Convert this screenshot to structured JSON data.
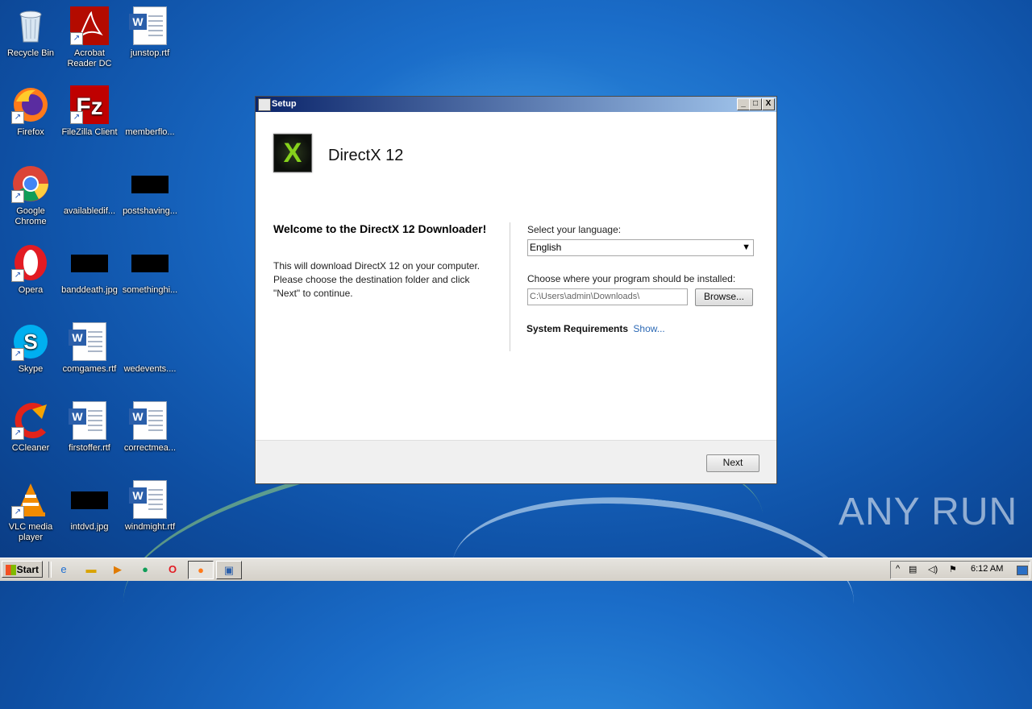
{
  "desktop": {
    "icons": [
      {
        "label": "Recycle Bin",
        "icon": "recycle-bin-icon"
      },
      {
        "label": "Acrobat Reader DC",
        "icon": "acrobat-icon"
      },
      {
        "label": "junstop.rtf",
        "icon": "word-doc-icon"
      },
      {
        "label": "Firefox",
        "icon": "firefox-icon"
      },
      {
        "label": "FileZilla Client",
        "icon": "filezilla-icon"
      },
      {
        "label": "memberflo...",
        "icon": "blank-file-icon"
      },
      {
        "label": "Google Chrome",
        "icon": "chrome-icon"
      },
      {
        "label": "availabledif...",
        "icon": "blank-file-icon"
      },
      {
        "label": "postshaving...",
        "icon": "image-thumbnail-icon"
      },
      {
        "label": "Opera",
        "icon": "opera-icon"
      },
      {
        "label": "banddeath.jpg",
        "icon": "image-thumbnail-icon"
      },
      {
        "label": "somethinghi...",
        "icon": "image-thumbnail-icon"
      },
      {
        "label": "Skype",
        "icon": "skype-icon"
      },
      {
        "label": "comgames.rtf",
        "icon": "word-doc-icon"
      },
      {
        "label": "wedevents....",
        "icon": "blank-file-icon"
      },
      {
        "label": "CCleaner",
        "icon": "ccleaner-icon"
      },
      {
        "label": "firstoffer.rtf",
        "icon": "word-doc-icon"
      },
      {
        "label": "correctmea...",
        "icon": "word-doc-icon"
      },
      {
        "label": "VLC media player",
        "icon": "vlc-icon"
      },
      {
        "label": "intdvd.jpg",
        "icon": "image-thumbnail-icon"
      },
      {
        "label": "windmight.rtf",
        "icon": "word-doc-icon"
      }
    ]
  },
  "dialog": {
    "title": "Setup",
    "window_buttons": {
      "minimize": "_",
      "maximize": "□",
      "close": "X"
    },
    "product_title": "DirectX 12",
    "logo_letter": "X",
    "welcome_heading": "Welcome to the DirectX 12 Downloader!",
    "intro_text": "This will download DirectX 12 on your computer. Please choose the destination folder and click \"Next\" to continue.",
    "language_label": "Select your language:",
    "language_value": "English",
    "install_label": "Choose where your program should be installed:",
    "install_path": "C:\\Users\\admin\\Downloads\\",
    "browse_label": "Browse...",
    "sysreq_label": "System Requirements",
    "sysreq_link": "Show...",
    "next_label": "Next"
  },
  "watermark": "ANY RUN",
  "taskbar": {
    "start_label": "Start",
    "clock": "6:12 AM"
  }
}
